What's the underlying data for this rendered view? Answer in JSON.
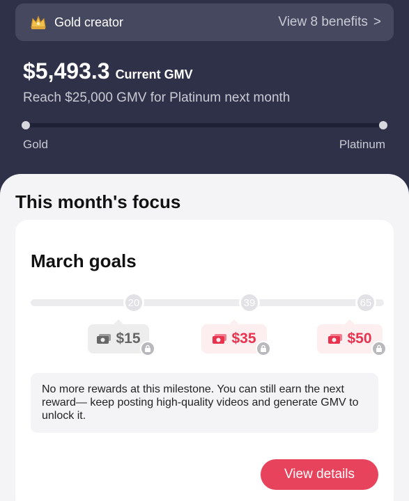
{
  "tier": {
    "label": "Gold creator",
    "benefits_link": "View 8 benefits",
    "chevron": ">",
    "icon": "crown-badge-icon"
  },
  "gmv": {
    "value": "$5,493.3",
    "caption": "Current GMV",
    "reach_text": "Reach $25,000 GMV for Platinum next month",
    "progress_fraction": 0.0,
    "start_label": "Gold",
    "end_label": "Platinum"
  },
  "focus": {
    "title": "This month's focus",
    "card": {
      "title": "March goals",
      "milestones": [
        {
          "count": "20",
          "reward": "$15",
          "style": "grey"
        },
        {
          "count": "39",
          "reward": "$35",
          "style": "pink"
        },
        {
          "count": "65",
          "reward": "$50",
          "style": "pink"
        }
      ],
      "notice": "No more rewards at this milestone. You can still earn the next reward— keep posting high-quality videos and generate GMV to unlock it.",
      "button_label": "View details"
    }
  },
  "colors": {
    "header_bg": "#2f3149",
    "accent": "#e8435c",
    "reward_pink": "#e8334f"
  }
}
